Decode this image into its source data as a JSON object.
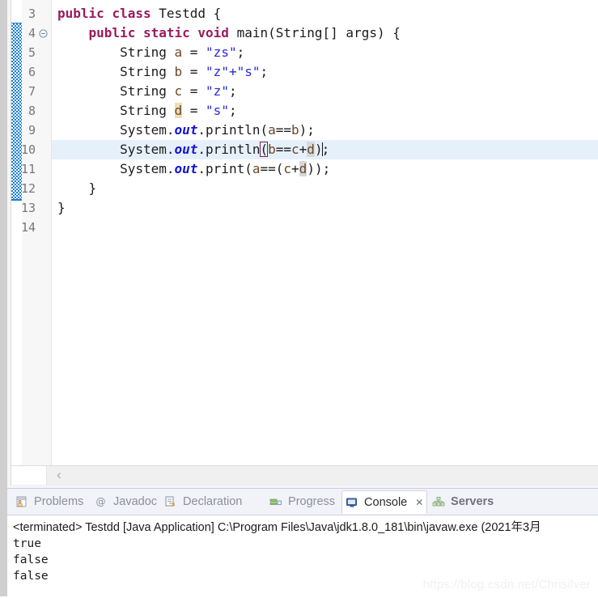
{
  "editor": {
    "first_visible_partial_line": "2",
    "lines": [
      {
        "num": "3",
        "fold": false,
        "indent": 0,
        "current": false,
        "tokens": [
          {
            "t": "public",
            "c": "kw"
          },
          {
            "t": " ",
            "c": "plain"
          },
          {
            "t": "class",
            "c": "kw"
          },
          {
            "t": " ",
            "c": "plain"
          },
          {
            "t": "Testdd",
            "c": "type"
          },
          {
            "t": " {",
            "c": "plain"
          }
        ],
        "text": "public class Testdd {"
      },
      {
        "num": "4",
        "fold": true,
        "indent": 1,
        "current": false,
        "text": "    public static void main(String[] args) {"
      },
      {
        "num": "5",
        "fold": false,
        "indent": 2,
        "current": false,
        "text": "        String a = \"zs\";"
      },
      {
        "num": "6",
        "fold": false,
        "indent": 2,
        "current": false,
        "text": "        String b = \"z\"+\"s\";"
      },
      {
        "num": "7",
        "fold": false,
        "indent": 2,
        "current": false,
        "text": "        String c = \"z\";"
      },
      {
        "num": "8",
        "fold": false,
        "indent": 2,
        "current": false,
        "text": "        String d = \"s\";"
      },
      {
        "num": "9",
        "fold": false,
        "indent": 2,
        "current": false,
        "text": "        System.out.println(a==b);"
      },
      {
        "num": "10",
        "fold": false,
        "indent": 2,
        "current": true,
        "text": "        System.out.println(b==c+d);"
      },
      {
        "num": "11",
        "fold": false,
        "indent": 2,
        "current": false,
        "text": "        System.out.print(a==(c+d));"
      },
      {
        "num": "12",
        "fold": false,
        "indent": 1,
        "current": false,
        "text": "    }"
      },
      {
        "num": "13",
        "fold": false,
        "indent": 0,
        "current": false,
        "text": "}"
      },
      {
        "num": "14",
        "fold": false,
        "indent": 0,
        "current": false,
        "text": ""
      }
    ],
    "keywords": [
      "public",
      "class",
      "static",
      "void"
    ],
    "class_name": "Testdd",
    "scrollbar": {
      "left_arrow": "‹"
    },
    "colors": {
      "keyword": "#9b1b5c",
      "string": "#2a2ad6",
      "variable": "#6b4726",
      "static_field": "#1414d6",
      "current_line_bg": "#e6f0fb",
      "occurrence_bg": "#d8d8d8",
      "write_occurrence_bg": "#f0ddb5",
      "bracket_match_border": "#7d2246",
      "annotation_bar": "#1a7ed4"
    }
  },
  "bottom_panel": {
    "tabs": [
      {
        "label": "Problems",
        "icon": "problems-icon",
        "active": false,
        "bold": false,
        "closable": false
      },
      {
        "label": "Javadoc",
        "icon": "javadoc-icon",
        "active": false,
        "bold": false,
        "closable": false
      },
      {
        "label": "Declaration",
        "icon": "declaration-icon",
        "active": false,
        "bold": false,
        "closable": false
      },
      {
        "label": "Progress",
        "icon": "progress-icon",
        "active": false,
        "bold": false,
        "closable": false
      },
      {
        "label": "Console",
        "icon": "console-icon",
        "active": true,
        "bold": false,
        "closable": true
      },
      {
        "label": "Servers",
        "icon": "servers-icon",
        "active": false,
        "bold": true,
        "closable": false
      }
    ],
    "close_glyph": "✕",
    "console": {
      "header": "<terminated> Testdd [Java Application] C:\\Program Files\\Java\\jdk1.8.0_181\\bin\\javaw.exe (2021年3月",
      "output": [
        "true",
        "false",
        "false"
      ]
    }
  },
  "watermark": {
    "text": "https://blog.csdn.net/Chrisilver"
  }
}
